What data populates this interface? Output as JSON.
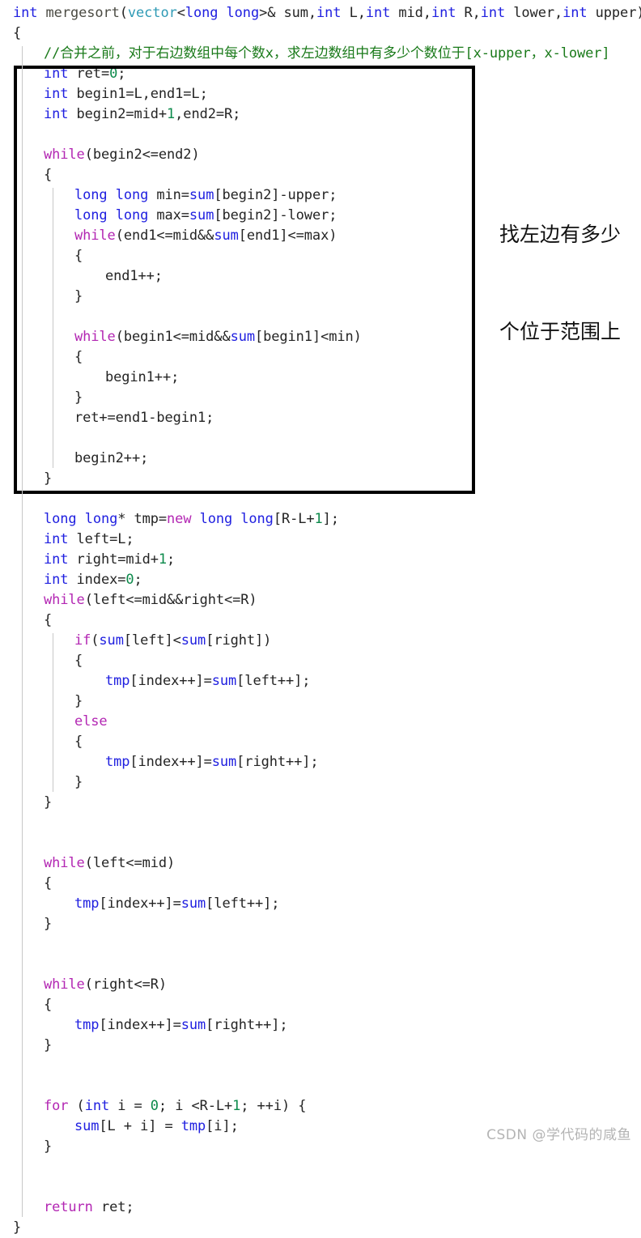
{
  "meta": {
    "language": "C++",
    "function_name": "mergesort",
    "background_color": "#ffffff",
    "highlight_box_color": "#000000",
    "watermark_color": "#b4b4b4"
  },
  "colors": {
    "plain": "#242424",
    "type": "#2020e0",
    "keyword": "#b327b3",
    "function": "#4a4a42",
    "class": "#2e9ab5",
    "number": "#0c8a4b",
    "comment": "#1a7a1a"
  },
  "annotation": {
    "line1": "找左边有多少",
    "line2": "个位于范围上"
  },
  "watermark": {
    "text": "CSDN @学代码的咸鱼"
  },
  "code": {
    "lines": [
      {
        "indent": 0,
        "tokens": [
          {
            "t": "int",
            "c": "type"
          },
          {
            "t": " ",
            "c": "plain"
          },
          {
            "t": "mergesort",
            "c": "function"
          },
          {
            "t": "(",
            "c": "punc"
          },
          {
            "t": "vector",
            "c": "class"
          },
          {
            "t": "<",
            "c": "punc"
          },
          {
            "t": "long long",
            "c": "type"
          },
          {
            "t": ">& sum,",
            "c": "plain"
          },
          {
            "t": "int",
            "c": "type"
          },
          {
            "t": " L,",
            "c": "plain"
          },
          {
            "t": "int",
            "c": "type"
          },
          {
            "t": " mid,",
            "c": "plain"
          },
          {
            "t": "int",
            "c": "type"
          },
          {
            "t": " R,",
            "c": "plain"
          },
          {
            "t": "int",
            "c": "type"
          },
          {
            "t": " lower,",
            "c": "plain"
          },
          {
            "t": "int",
            "c": "type"
          },
          {
            "t": " upper)",
            "c": "plain"
          }
        ]
      },
      {
        "indent": 0,
        "tokens": [
          {
            "t": "{",
            "c": "plain"
          }
        ]
      },
      {
        "indent": 1,
        "tokens": [
          {
            "t": "//合并之前，对于右边数组中每个数x，求左边数组中有多少个数位于[x-upper，x-lower]",
            "c": "comment"
          }
        ]
      },
      {
        "indent": 1,
        "tokens": [
          {
            "t": "int",
            "c": "type"
          },
          {
            "t": " ret=",
            "c": "plain"
          },
          {
            "t": "0",
            "c": "number"
          },
          {
            "t": ";",
            "c": "plain"
          }
        ]
      },
      {
        "indent": 1,
        "tokens": [
          {
            "t": "int",
            "c": "type"
          },
          {
            "t": " begin1=L,end1=L;",
            "c": "plain"
          }
        ]
      },
      {
        "indent": 1,
        "tokens": [
          {
            "t": "int",
            "c": "type"
          },
          {
            "t": " begin2=mid+",
            "c": "plain"
          },
          {
            "t": "1",
            "c": "number"
          },
          {
            "t": ",end2=R;",
            "c": "plain"
          }
        ]
      },
      {
        "indent": 1,
        "tokens": []
      },
      {
        "indent": 1,
        "tokens": [
          {
            "t": "while",
            "c": "keyword"
          },
          {
            "t": "(begin2<=end2)",
            "c": "plain"
          }
        ]
      },
      {
        "indent": 1,
        "tokens": [
          {
            "t": "{",
            "c": "plain"
          }
        ]
      },
      {
        "indent": 2,
        "tokens": [
          {
            "t": "long",
            "c": "type"
          },
          {
            "t": " ",
            "c": "plain"
          },
          {
            "t": "long",
            "c": "type"
          },
          {
            "t": " min=",
            "c": "plain"
          },
          {
            "t": "sum",
            "c": "var"
          },
          {
            "t": "[begin2]-upper;",
            "c": "plain"
          }
        ]
      },
      {
        "indent": 2,
        "tokens": [
          {
            "t": "long",
            "c": "type"
          },
          {
            "t": " ",
            "c": "plain"
          },
          {
            "t": "long",
            "c": "type"
          },
          {
            "t": " max=",
            "c": "plain"
          },
          {
            "t": "sum",
            "c": "var"
          },
          {
            "t": "[begin2]-lower;",
            "c": "plain"
          }
        ]
      },
      {
        "indent": 2,
        "tokens": [
          {
            "t": "while",
            "c": "keyword"
          },
          {
            "t": "(end1<=mid&&",
            "c": "plain"
          },
          {
            "t": "sum",
            "c": "var"
          },
          {
            "t": "[end1]<=max)",
            "c": "plain"
          }
        ]
      },
      {
        "indent": 2,
        "tokens": [
          {
            "t": "{",
            "c": "plain"
          }
        ]
      },
      {
        "indent": 3,
        "tokens": [
          {
            "t": "end1++;",
            "c": "plain"
          }
        ]
      },
      {
        "indent": 2,
        "tokens": [
          {
            "t": "}",
            "c": "plain"
          }
        ]
      },
      {
        "indent": 2,
        "tokens": []
      },
      {
        "indent": 2,
        "tokens": [
          {
            "t": "while",
            "c": "keyword"
          },
          {
            "t": "(begin1<=mid&&",
            "c": "plain"
          },
          {
            "t": "sum",
            "c": "var"
          },
          {
            "t": "[begin1]<min)",
            "c": "plain"
          }
        ]
      },
      {
        "indent": 2,
        "tokens": [
          {
            "t": "{",
            "c": "plain"
          }
        ]
      },
      {
        "indent": 3,
        "tokens": [
          {
            "t": "begin1++;",
            "c": "plain"
          }
        ]
      },
      {
        "indent": 2,
        "tokens": [
          {
            "t": "}",
            "c": "plain"
          }
        ]
      },
      {
        "indent": 2,
        "tokens": [
          {
            "t": "ret+=end1-begin1;",
            "c": "plain"
          }
        ]
      },
      {
        "indent": 2,
        "tokens": []
      },
      {
        "indent": 2,
        "tokens": [
          {
            "t": "begin2++;",
            "c": "plain"
          }
        ]
      },
      {
        "indent": 1,
        "tokens": [
          {
            "t": "}",
            "c": "plain"
          }
        ]
      },
      {
        "indent": 1,
        "tokens": []
      },
      {
        "indent": 1,
        "tokens": [
          {
            "t": "long",
            "c": "type"
          },
          {
            "t": " ",
            "c": "plain"
          },
          {
            "t": "long",
            "c": "type"
          },
          {
            "t": "* tmp=",
            "c": "plain"
          },
          {
            "t": "new",
            "c": "keyword"
          },
          {
            "t": " ",
            "c": "plain"
          },
          {
            "t": "long",
            "c": "type"
          },
          {
            "t": " ",
            "c": "plain"
          },
          {
            "t": "long",
            "c": "type"
          },
          {
            "t": "[R-L+",
            "c": "plain"
          },
          {
            "t": "1",
            "c": "number"
          },
          {
            "t": "];",
            "c": "plain"
          }
        ]
      },
      {
        "indent": 1,
        "tokens": [
          {
            "t": "int",
            "c": "type"
          },
          {
            "t": " left=L;",
            "c": "plain"
          }
        ]
      },
      {
        "indent": 1,
        "tokens": [
          {
            "t": "int",
            "c": "type"
          },
          {
            "t": " right=mid+",
            "c": "plain"
          },
          {
            "t": "1",
            "c": "number"
          },
          {
            "t": ";",
            "c": "plain"
          }
        ]
      },
      {
        "indent": 1,
        "tokens": [
          {
            "t": "int",
            "c": "type"
          },
          {
            "t": " index=",
            "c": "plain"
          },
          {
            "t": "0",
            "c": "number"
          },
          {
            "t": ";",
            "c": "plain"
          }
        ]
      },
      {
        "indent": 1,
        "tokens": [
          {
            "t": "while",
            "c": "keyword"
          },
          {
            "t": "(left<=mid&&right<=R)",
            "c": "plain"
          }
        ]
      },
      {
        "indent": 1,
        "tokens": [
          {
            "t": "{",
            "c": "plain"
          }
        ]
      },
      {
        "indent": 2,
        "tokens": [
          {
            "t": "if",
            "c": "keyword"
          },
          {
            "t": "(",
            "c": "plain"
          },
          {
            "t": "sum",
            "c": "var"
          },
          {
            "t": "[left]<",
            "c": "plain"
          },
          {
            "t": "sum",
            "c": "var"
          },
          {
            "t": "[right])",
            "c": "plain"
          }
        ]
      },
      {
        "indent": 2,
        "tokens": [
          {
            "t": "{",
            "c": "plain"
          }
        ]
      },
      {
        "indent": 3,
        "tokens": [
          {
            "t": "tmp",
            "c": "var"
          },
          {
            "t": "[index++]=",
            "c": "plain"
          },
          {
            "t": "sum",
            "c": "var"
          },
          {
            "t": "[left++];",
            "c": "plain"
          }
        ]
      },
      {
        "indent": 2,
        "tokens": [
          {
            "t": "}",
            "c": "plain"
          }
        ]
      },
      {
        "indent": 2,
        "tokens": [
          {
            "t": "else",
            "c": "keyword"
          }
        ]
      },
      {
        "indent": 2,
        "tokens": [
          {
            "t": "{",
            "c": "plain"
          }
        ]
      },
      {
        "indent": 3,
        "tokens": [
          {
            "t": "tmp",
            "c": "var"
          },
          {
            "t": "[index++]=",
            "c": "plain"
          },
          {
            "t": "sum",
            "c": "var"
          },
          {
            "t": "[right++];",
            "c": "plain"
          }
        ]
      },
      {
        "indent": 2,
        "tokens": [
          {
            "t": "}",
            "c": "plain"
          }
        ]
      },
      {
        "indent": 1,
        "tokens": [
          {
            "t": "}",
            "c": "plain"
          }
        ]
      },
      {
        "indent": 1,
        "tokens": []
      },
      {
        "indent": 1,
        "tokens": []
      },
      {
        "indent": 1,
        "tokens": [
          {
            "t": "while",
            "c": "keyword"
          },
          {
            "t": "(left<=mid)",
            "c": "plain"
          }
        ]
      },
      {
        "indent": 1,
        "tokens": [
          {
            "t": "{",
            "c": "plain"
          }
        ]
      },
      {
        "indent": 2,
        "tokens": [
          {
            "t": "tmp",
            "c": "var"
          },
          {
            "t": "[index++]=",
            "c": "plain"
          },
          {
            "t": "sum",
            "c": "var"
          },
          {
            "t": "[left++];",
            "c": "plain"
          }
        ]
      },
      {
        "indent": 1,
        "tokens": [
          {
            "t": "}",
            "c": "plain"
          }
        ]
      },
      {
        "indent": 1,
        "tokens": []
      },
      {
        "indent": 1,
        "tokens": []
      },
      {
        "indent": 1,
        "tokens": [
          {
            "t": "while",
            "c": "keyword"
          },
          {
            "t": "(right<=R)",
            "c": "plain"
          }
        ]
      },
      {
        "indent": 1,
        "tokens": [
          {
            "t": "{",
            "c": "plain"
          }
        ]
      },
      {
        "indent": 2,
        "tokens": [
          {
            "t": "tmp",
            "c": "var"
          },
          {
            "t": "[index++]=",
            "c": "plain"
          },
          {
            "t": "sum",
            "c": "var"
          },
          {
            "t": "[right++];",
            "c": "plain"
          }
        ]
      },
      {
        "indent": 1,
        "tokens": [
          {
            "t": "}",
            "c": "plain"
          }
        ]
      },
      {
        "indent": 1,
        "tokens": []
      },
      {
        "indent": 1,
        "tokens": []
      },
      {
        "indent": 1,
        "tokens": [
          {
            "t": "for",
            "c": "keyword"
          },
          {
            "t": " (",
            "c": "plain"
          },
          {
            "t": "int",
            "c": "type"
          },
          {
            "t": " i = ",
            "c": "plain"
          },
          {
            "t": "0",
            "c": "number"
          },
          {
            "t": "; i <R-L+",
            "c": "plain"
          },
          {
            "t": "1",
            "c": "number"
          },
          {
            "t": "; ++i) {",
            "c": "plain"
          }
        ]
      },
      {
        "indent": 2,
        "tokens": [
          {
            "t": "sum",
            "c": "var"
          },
          {
            "t": "[L + i] = ",
            "c": "plain"
          },
          {
            "t": "tmp",
            "c": "var"
          },
          {
            "t": "[i];",
            "c": "plain"
          }
        ]
      },
      {
        "indent": 1,
        "tokens": [
          {
            "t": "}",
            "c": "plain"
          }
        ]
      },
      {
        "indent": 1,
        "tokens": []
      },
      {
        "indent": 1,
        "tokens": []
      },
      {
        "indent": 1,
        "tokens": [
          {
            "t": "return",
            "c": "keyword"
          },
          {
            "t": " ret;",
            "c": "plain"
          }
        ]
      },
      {
        "indent": 0,
        "tokens": [
          {
            "t": "}",
            "c": "plain"
          }
        ]
      }
    ]
  }
}
